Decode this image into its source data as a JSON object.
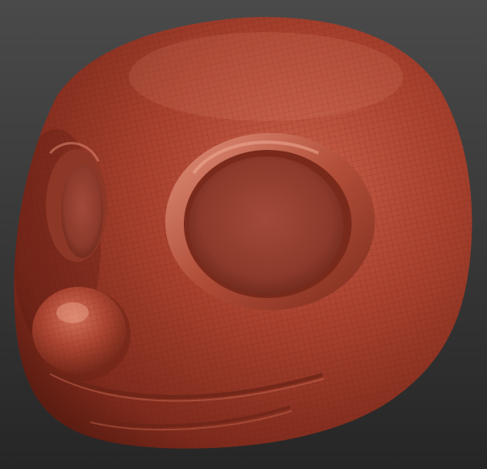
{
  "viewport": {
    "background_top": "#4a4a4a",
    "background_bottom": "#262626"
  },
  "model": {
    "icon": "sculpt-head-mesh-icon",
    "material_base": "#a8412e",
    "material_dark": "#5e1d12",
    "material_highlight": "#e08a73",
    "wireframe_color": "#6a2417"
  }
}
